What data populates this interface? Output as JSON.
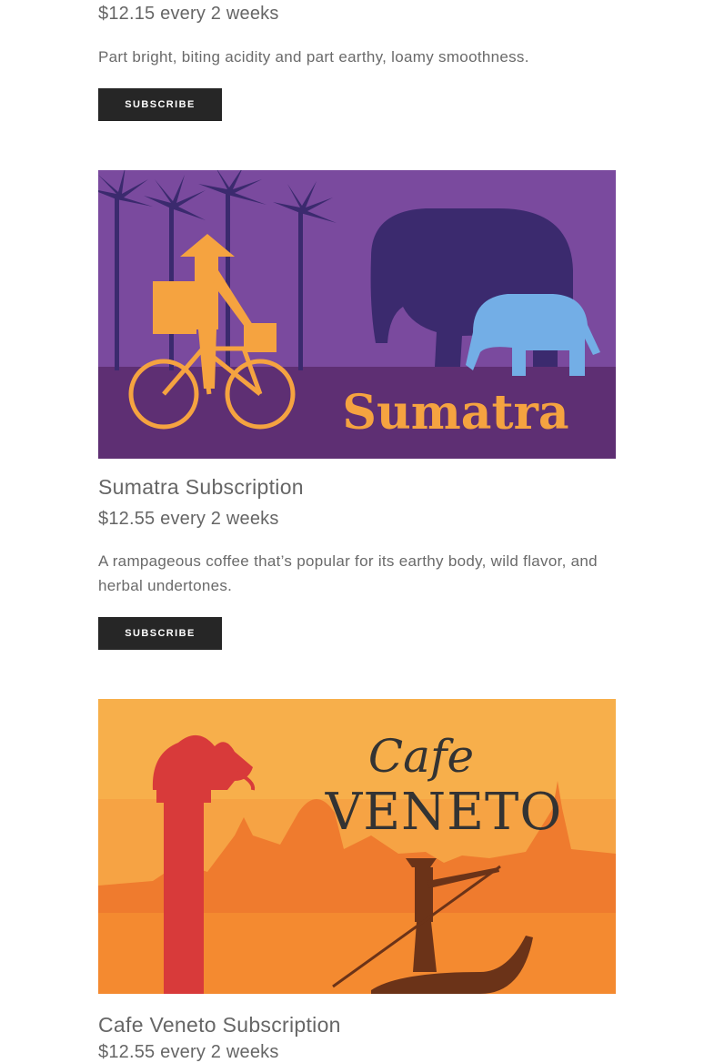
{
  "products": [
    {
      "price": "$12.15 every 2 weeks",
      "description": "Part bright, biting acidity and part earthy, loamy smoothness.",
      "button_label": "SUBSCRIBE"
    },
    {
      "image_alt": "Sumatra",
      "image_text": "Sumatra",
      "title": "Sumatra Subscription",
      "price": "$12.55 every 2 weeks",
      "description": "A rampageous coffee that’s popular for its earthy body, wild flavor, and herbal undertones.",
      "button_label": "SUBSCRIBE"
    },
    {
      "image_alt": "Cafe Veneto",
      "image_text_script": "Cafe",
      "image_text": "VENETO",
      "title": "Cafe Veneto Subscription",
      "price": "$12.55 every 2 weeks"
    }
  ],
  "colors": {
    "button": "#262626",
    "sumatra_sky": "#7a4a9e",
    "sumatra_ground": "#5e2f73",
    "sumatra_orange": "#f5a340",
    "sumatra_navy": "#3b2a6e",
    "sumatra_blue": "#73aee6",
    "veneto_orange": "#f6a344",
    "veneto_red": "#d83a3a",
    "veneto_brown": "#6b3318",
    "veneto_text": "#333333"
  }
}
